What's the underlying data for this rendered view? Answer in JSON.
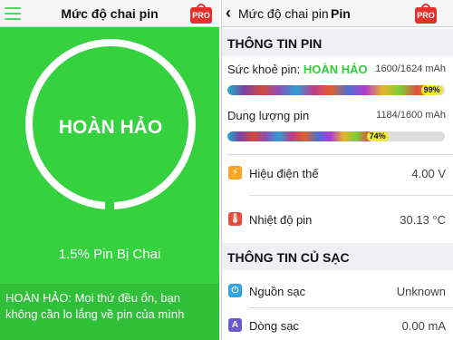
{
  "left": {
    "title": "Mức độ chai pin",
    "pro_badge": "PRO",
    "status": "HOÀN HẢO",
    "wear": "1.5% Pin Bị Chai",
    "message": "HOÀN HẢO: Mọi thứ đều ổn, bạn không cần lo lắng về pin của mình"
  },
  "right": {
    "back_label": "Mức độ chai pin",
    "title": "Pin",
    "pro_badge": "PRO",
    "battery_info": {
      "header": "THÔNG TIN PIN",
      "health_label": "Sức khoẻ pin:",
      "health_status": "HOÀN HẢO",
      "health_value": "1600/1624 mAh",
      "health_percent": 99,
      "health_percent_text": "99%",
      "capacity_label": "Dung lượng pin",
      "capacity_value": "1184/1600 mAh",
      "capacity_percent": 74,
      "capacity_percent_text": "74%",
      "voltage_label": "Hiệu điện thế",
      "voltage_value": "4.00 V",
      "temp_label": "Nhiệt độ pin",
      "temp_value": "30.13 °C"
    },
    "charge_info": {
      "header": "THÔNG TIN CỦ SẠC",
      "source_label": "Nguồn sạc",
      "source_value": "Unknown",
      "current_label": "Dòng sạc",
      "current_value": "0.00 mA"
    }
  },
  "icons": {
    "hamburger": "menu-icon",
    "pro": "pro-bag-icon",
    "back": "chevron-left-icon",
    "voltage": "lightning-icon",
    "temperature": "thermometer-icon",
    "source": "plug-icon",
    "current": "ampere-icon"
  },
  "colors": {
    "accent_green": "#35d13f",
    "good_text": "#2fcc3a",
    "pro_red": "#e3322b",
    "voltage_icon": "#f5a623",
    "temp_icon": "#e74c3c",
    "source_icon": "#2fa4e7",
    "current_icon": "#6a5acd"
  }
}
